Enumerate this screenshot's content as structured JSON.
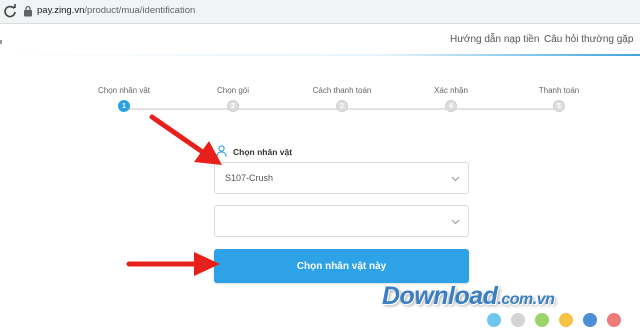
{
  "browser": {
    "url_host": "pay.zing.vn",
    "url_path": "/product/mua/identification"
  },
  "header": {
    "nav": [
      {
        "label": "Hướng dẫn nạp tiền"
      },
      {
        "label": "Câu hỏi thường gặp"
      }
    ]
  },
  "stepper": {
    "steps": [
      {
        "label": "Chọn nhân vật",
        "number": "1",
        "active": true
      },
      {
        "label": "Chọn gói",
        "number": "2",
        "active": false
      },
      {
        "label": "Cách thanh toán",
        "number": "3",
        "active": false
      },
      {
        "label": "Xác nhận",
        "number": "4",
        "active": false
      },
      {
        "label": "Thanh toán",
        "number": "5",
        "active": false
      }
    ],
    "progress": 0
  },
  "form": {
    "character_label": "Chọn nhân vật",
    "server_select_value": "S107-Crush",
    "character_select_value": "",
    "submit_label": "Chọn nhân vật này"
  },
  "colors": {
    "accent": "#2ea2e7",
    "arrow": "#e8201c",
    "watermark": "#3a7fc4"
  },
  "watermark": {
    "text": "Download",
    "suffix": ".com.vn",
    "dot_colors": [
      "#6ec6ef",
      "#d4d4d4",
      "#9bd36a",
      "#f7c244",
      "#4a8fd6",
      "#f07a7a"
    ]
  }
}
